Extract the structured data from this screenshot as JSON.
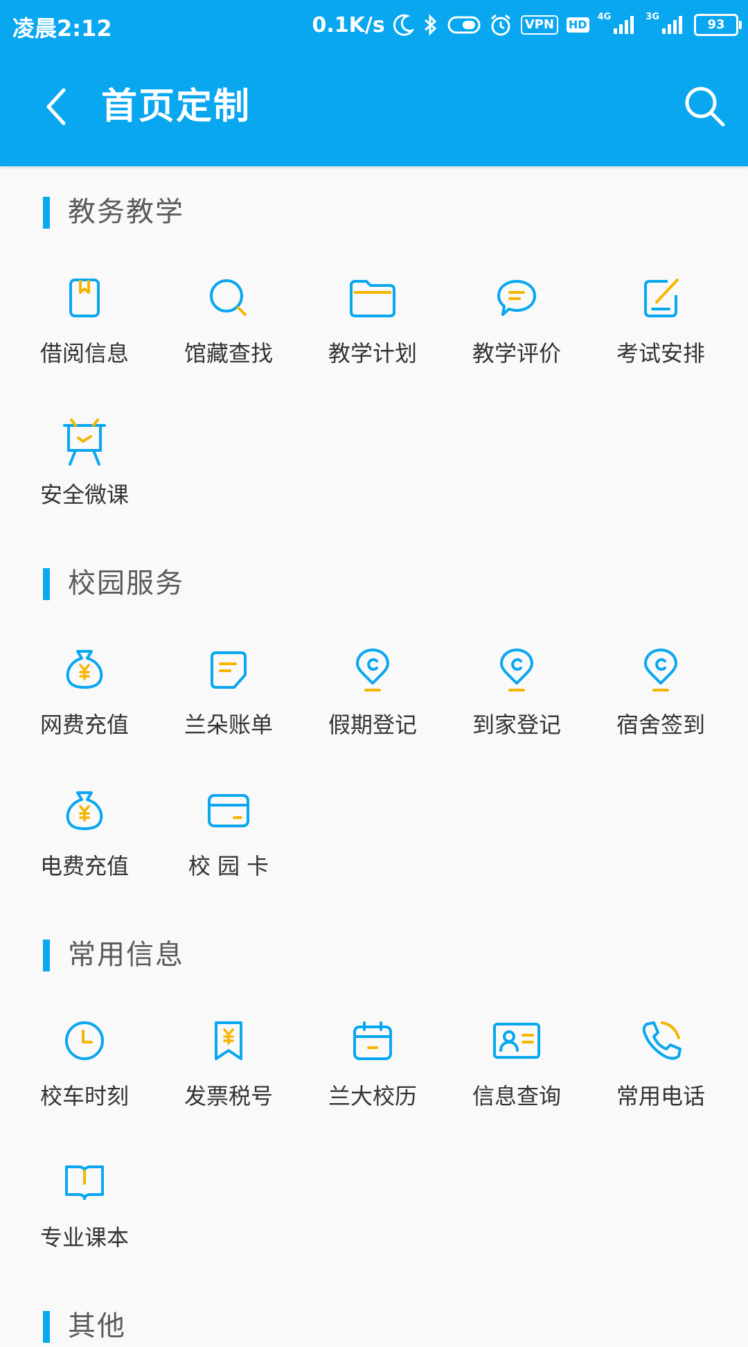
{
  "status_bar": {
    "time": "凌晨2:12",
    "speed": "0.1K/s",
    "vpn": "VPN",
    "hd": "HD",
    "net1": "4G",
    "net2": "3G",
    "battery": "93"
  },
  "app_bar": {
    "title": "首页定制"
  },
  "colors": {
    "primary": "#08a7ef",
    "accent": "#f7b500",
    "background": "#f9f9fa",
    "text": "#333333",
    "section_text": "#5a5a5a"
  },
  "sections": [
    {
      "title": "教务教学",
      "items": [
        {
          "label": "借阅信息",
          "icon": "book-bookmark-icon"
        },
        {
          "label": "馆藏查找",
          "icon": "magnifier-icon"
        },
        {
          "label": "教学计划",
          "icon": "folder-icon"
        },
        {
          "label": "教学评价",
          "icon": "chat-bubble-icon"
        },
        {
          "label": "考试安排",
          "icon": "edit-note-icon"
        },
        {
          "label": "安全微课",
          "icon": "easel-board-icon"
        }
      ]
    },
    {
      "title": "校园服务",
      "items": [
        {
          "label": "网费充值",
          "icon": "money-bag-icon"
        },
        {
          "label": "兰朵账单",
          "icon": "bill-icon"
        },
        {
          "label": "假期登记",
          "icon": "location-pin-icon"
        },
        {
          "label": "到家登记",
          "icon": "location-pin-icon"
        },
        {
          "label": "宿舍签到",
          "icon": "location-pin-icon"
        },
        {
          "label": "电费充值",
          "icon": "money-bag-icon"
        },
        {
          "label": "校 园 卡",
          "icon": "card-icon"
        }
      ]
    },
    {
      "title": "常用信息",
      "items": [
        {
          "label": "校车时刻",
          "icon": "clock-icon"
        },
        {
          "label": "发票税号",
          "icon": "ticket-yen-icon"
        },
        {
          "label": "兰大校历",
          "icon": "calendar-icon"
        },
        {
          "label": "信息查询",
          "icon": "id-card-icon"
        },
        {
          "label": "常用电话",
          "icon": "phone-icon"
        },
        {
          "label": "专业课本",
          "icon": "open-book-icon"
        }
      ]
    },
    {
      "title": "其他",
      "items": []
    }
  ]
}
